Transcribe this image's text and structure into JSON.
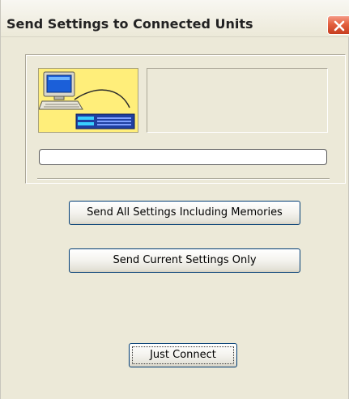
{
  "window": {
    "title": "Send Settings to Connected Units",
    "close_icon": "close-icon"
  },
  "panel": {
    "connection_icon": "computer-to-rack-unit-icon",
    "status_text": "",
    "progress": 0
  },
  "buttons": {
    "send_all_label": "Send All Settings Including Memories",
    "send_current_label": "Send Current Settings Only",
    "just_connect_label": "Just Connect"
  },
  "colors": {
    "dialog_background": "#ece9d8",
    "icon_tile_background": "#ffee7a",
    "close_button": "#e3603f",
    "button_border": "#003c74"
  }
}
